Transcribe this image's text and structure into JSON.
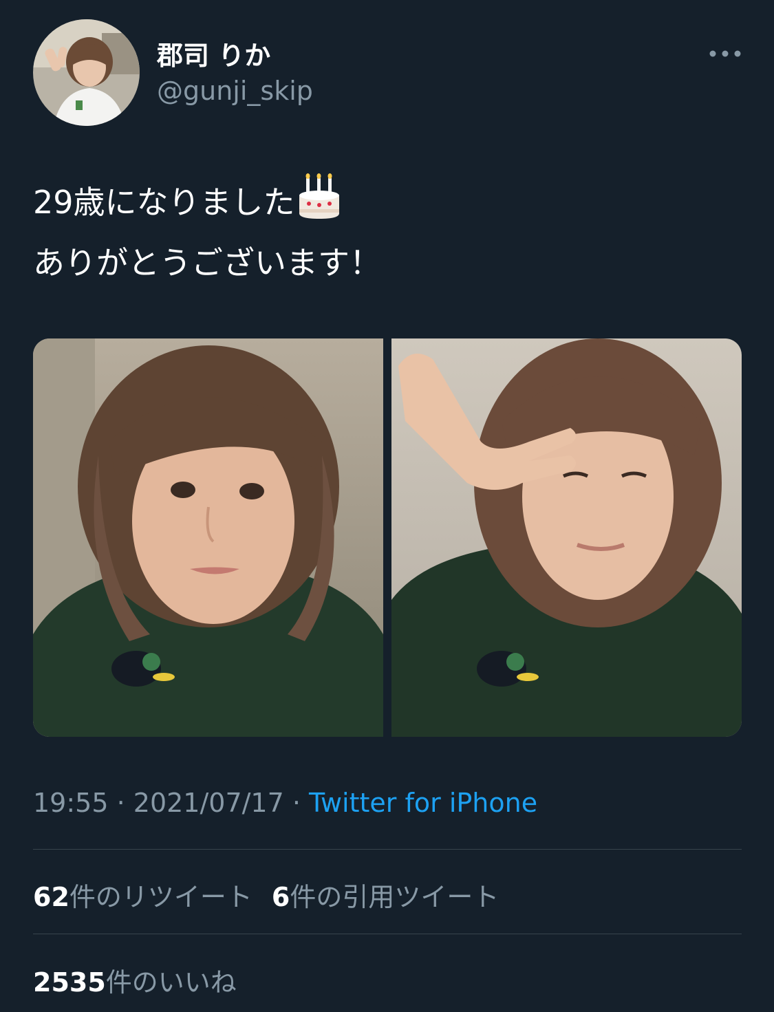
{
  "user": {
    "display_name": "郡司 りか",
    "handle": "@gunji_skip"
  },
  "tweet": {
    "line1": "29歳になりました",
    "line1_emoji": "birthday-cake-icon",
    "line2": "ありがとうございます！"
  },
  "meta": {
    "time": "19:55",
    "separator": " · ",
    "date": "2021/07/17",
    "source": "Twitter for iPhone"
  },
  "stats": {
    "retweets_count": "62",
    "retweets_label": "件のリツイート",
    "quotes_count": "6",
    "quotes_label": "件の引用ツイート",
    "likes_count": "2535",
    "likes_label": "件のいいね"
  },
  "colors": {
    "background": "#15202b",
    "text_primary": "#ffffff",
    "text_secondary": "#8899a6",
    "link": "#1da1f2",
    "divider": "#38444d"
  },
  "icons": [
    "more-icon",
    "birthday-cake-icon"
  ]
}
